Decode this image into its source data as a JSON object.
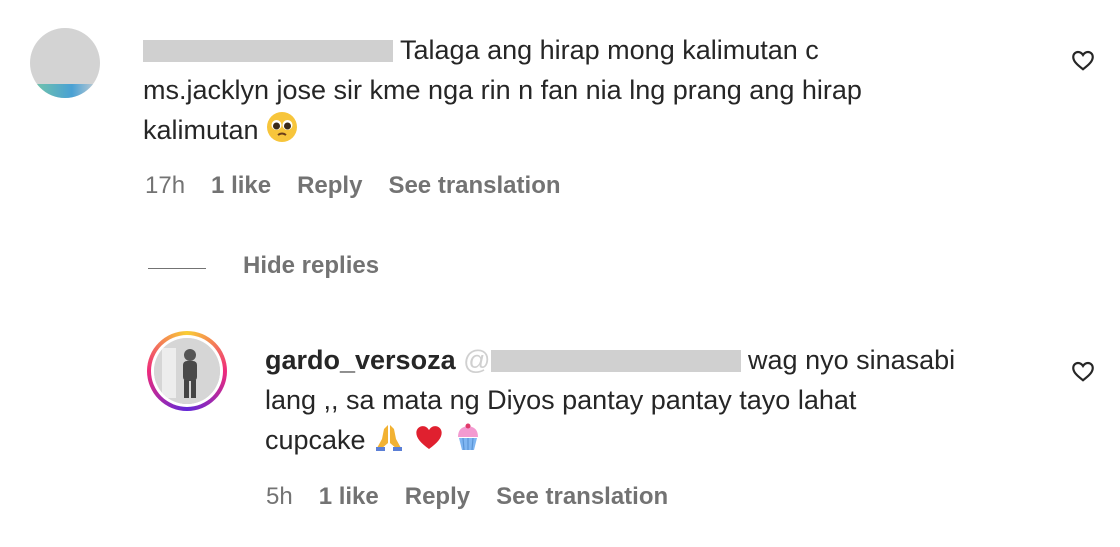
{
  "comment1": {
    "text_line1": "Talaga ang hirap mong kalimutan c",
    "text_line2": "ms.jacklyn jose sir kme nga rin n fan nia lng prang ang hirap",
    "text_line3": "kalimutan",
    "emoji": "pleading-face",
    "time": "17h",
    "likes": "1 like",
    "reply": "Reply",
    "translate": "See translation"
  },
  "hide_replies": "Hide replies",
  "reply1": {
    "username": "gardo_versoza",
    "mention_prefix": "@",
    "text_line1": "wag nyo sinasabi",
    "text_line2": "lang ,, sa mata ng Diyos pantay pantay tayo lahat",
    "text_line3": "cupcake",
    "emojis": [
      "folded-hands",
      "red-heart",
      "cupcake"
    ],
    "time": "5h",
    "likes": "1 like",
    "reply": "Reply",
    "translate": "See translation"
  }
}
